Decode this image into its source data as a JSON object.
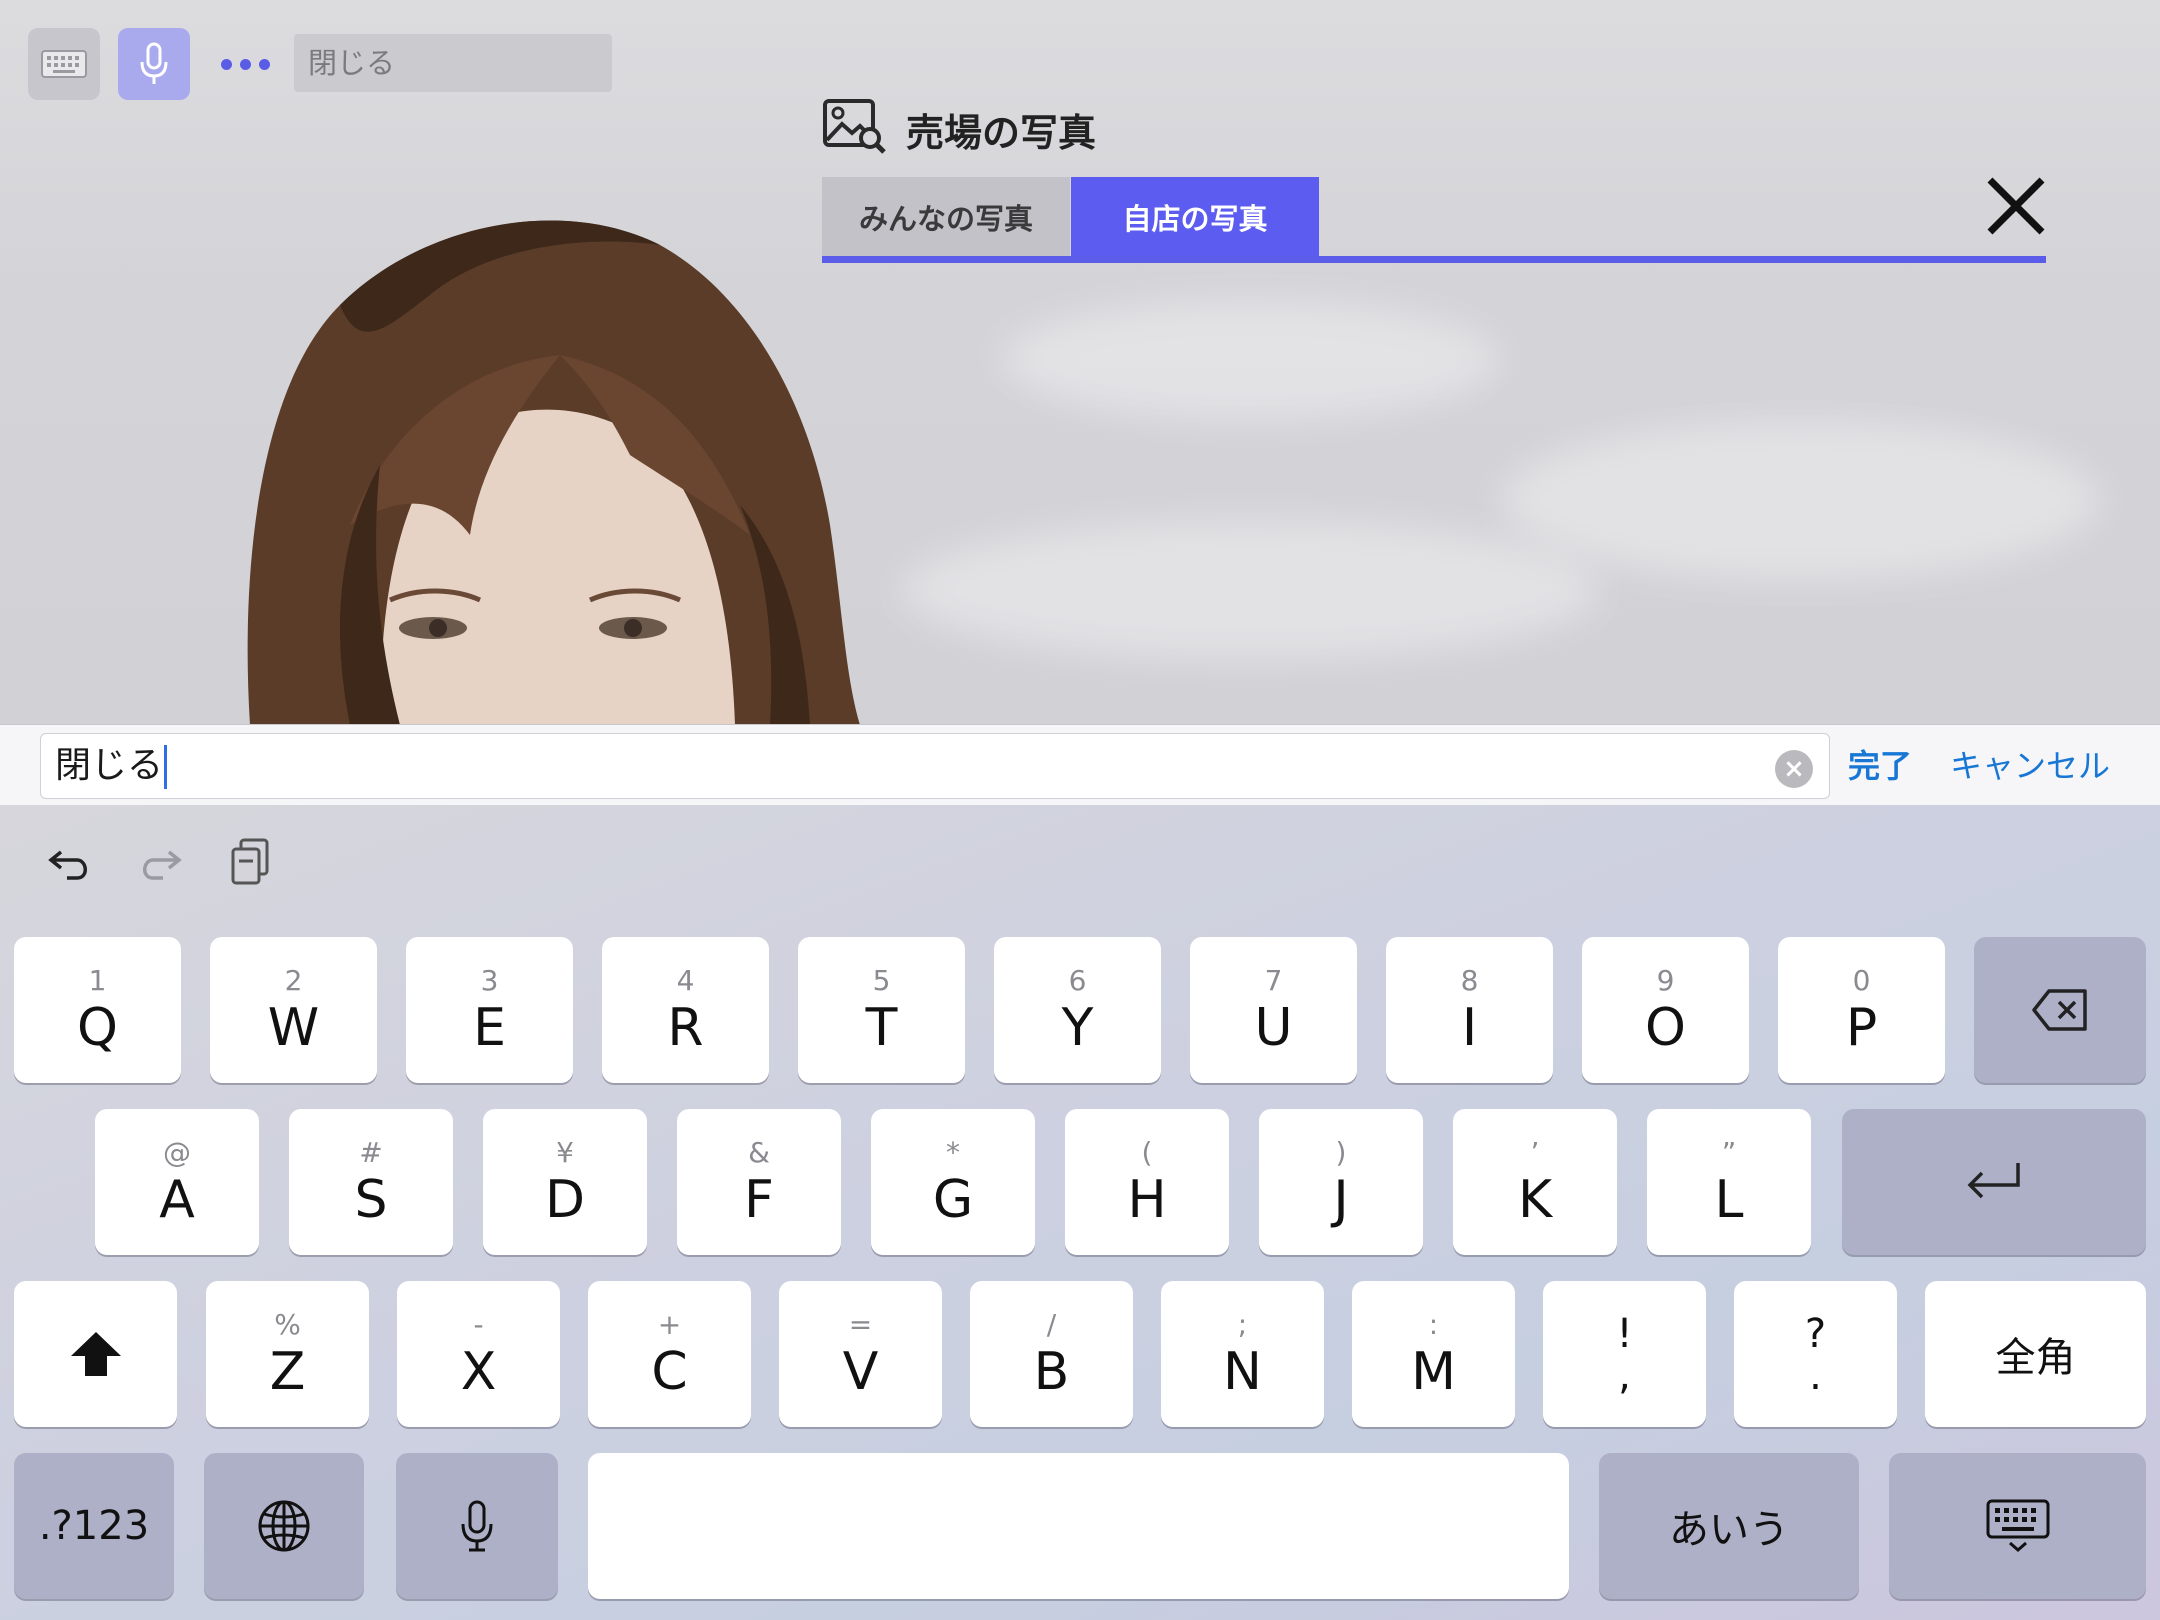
{
  "toolbar": {
    "field_text": "閉じる"
  },
  "panel": {
    "title": "売場の写真",
    "tabs": [
      {
        "label": "みんなの写真",
        "active": false
      },
      {
        "label": "自店の写真",
        "active": true
      }
    ],
    "accent_color": "#5b5ce8"
  },
  "input": {
    "value": "閉じる",
    "done_label": "完了",
    "cancel_label": "キャンセル"
  },
  "keyboard": {
    "row1": [
      {
        "sub": "1",
        "main": "Q"
      },
      {
        "sub": "2",
        "main": "W"
      },
      {
        "sub": "3",
        "main": "E"
      },
      {
        "sub": "4",
        "main": "R"
      },
      {
        "sub": "5",
        "main": "T"
      },
      {
        "sub": "6",
        "main": "Y"
      },
      {
        "sub": "7",
        "main": "U"
      },
      {
        "sub": "8",
        "main": "I"
      },
      {
        "sub": "9",
        "main": "O"
      },
      {
        "sub": "0",
        "main": "P"
      }
    ],
    "row2": [
      {
        "sub": "@",
        "main": "A"
      },
      {
        "sub": "#",
        "main": "S"
      },
      {
        "sub": "¥",
        "main": "D"
      },
      {
        "sub": "&",
        "main": "F"
      },
      {
        "sub": "*",
        "main": "G"
      },
      {
        "sub": "(",
        "main": "H"
      },
      {
        "sub": ")",
        "main": "J"
      },
      {
        "sub": "’",
        "main": "K"
      },
      {
        "sub": "”",
        "main": "L"
      }
    ],
    "row3": [
      {
        "sub": "%",
        "main": "Z"
      },
      {
        "sub": "-",
        "main": "X"
      },
      {
        "sub": "+",
        "main": "C"
      },
      {
        "sub": "=",
        "main": "V"
      },
      {
        "sub": "/",
        "main": "B"
      },
      {
        "sub": ";",
        "main": "N"
      },
      {
        "sub": ":",
        "main": "M"
      },
      {
        "sub": "!",
        "main": ","
      },
      {
        "sub": "?",
        "main": "."
      }
    ],
    "zenkaku_label": "全角",
    "numbers_label": ".?123",
    "kana_label": "あいう"
  }
}
